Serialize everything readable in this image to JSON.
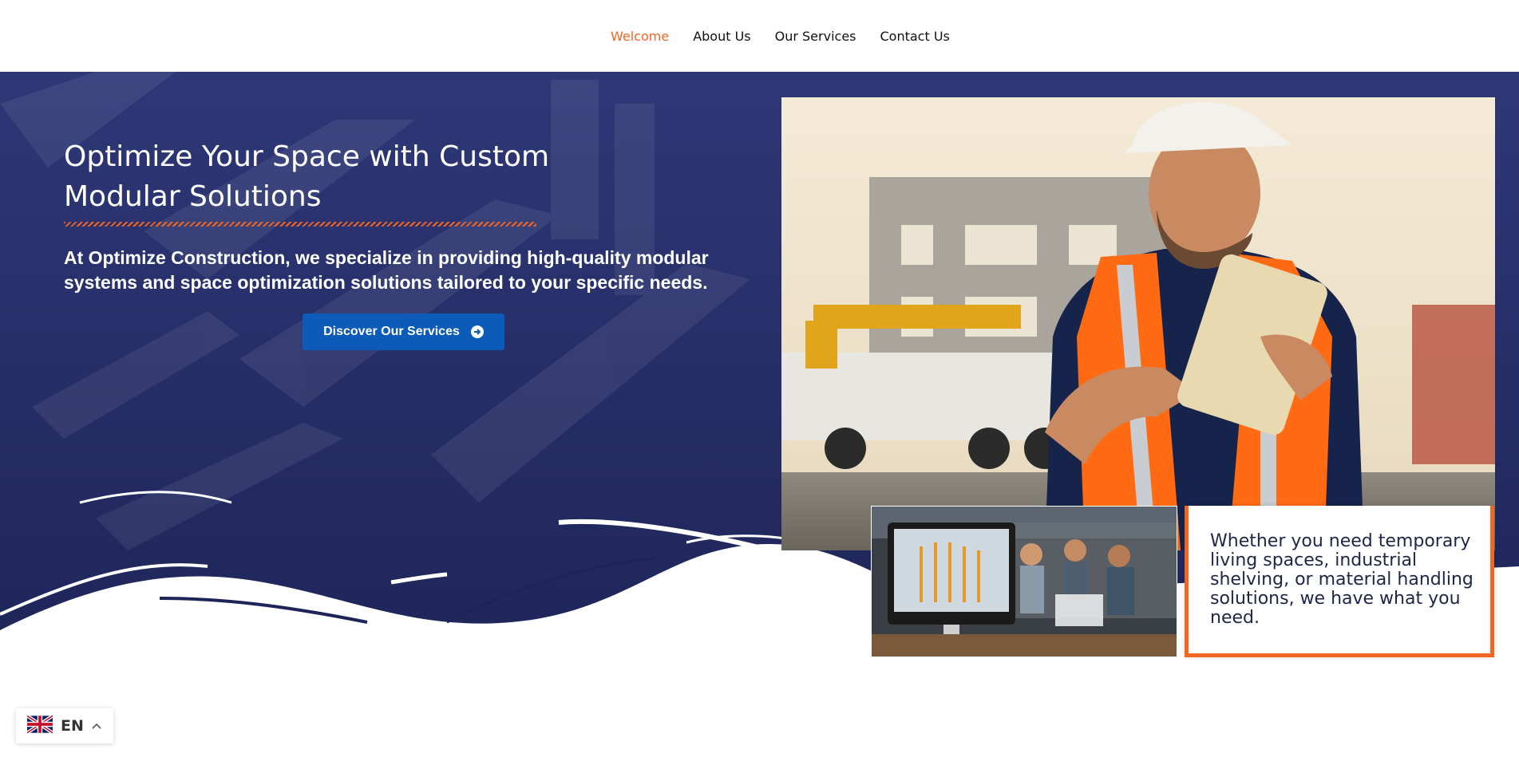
{
  "nav": {
    "items": [
      {
        "label": "Welcome",
        "active": true
      },
      {
        "label": "About Us",
        "active": false
      },
      {
        "label": "Our Services",
        "active": false
      },
      {
        "label": "Contact Us",
        "active": false
      }
    ]
  },
  "hero": {
    "title": "Optimize Your Space with Custom Modular Solutions",
    "subtitle": "At Optimize Construction, we specialize in providing high-quality modular systems and space optimization solutions tailored to your specific needs.",
    "cta_label": "Discover Our Services",
    "cta_icon": "arrow-circle-right-icon"
  },
  "quote": {
    "text": "Whether you need temporary living spaces, industrial shelving, or material handling solutions, we have what you need."
  },
  "language": {
    "code": "EN",
    "flag_icon": "uk-flag-icon"
  },
  "colors": {
    "accent": "#f26522",
    "hero_bg": "#27306a",
    "button_bg": "#0c5bb8",
    "quote_text": "#1f2548"
  },
  "images": {
    "main_photo": "construction-worker-with-tablet-photo",
    "secondary_photo": "design-team-with-computer-photo"
  }
}
